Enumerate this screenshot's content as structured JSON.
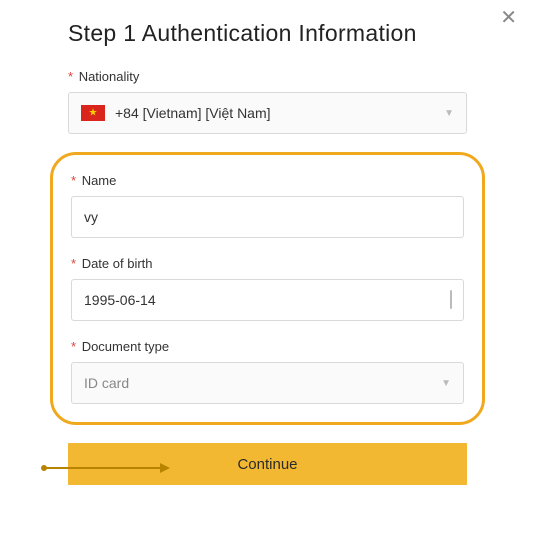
{
  "title": "Step 1 Authentication Information",
  "close_label": "✕",
  "nationality": {
    "label": "Nationality",
    "value": "+84 [Vietnam] [Việt Nam]"
  },
  "name": {
    "label": "Name",
    "value": "vy"
  },
  "dob": {
    "label": "Date of birth",
    "value": "1995-06-14"
  },
  "doctype": {
    "label": "Document type",
    "value": "ID card"
  },
  "continue_label": "Continue",
  "required_marker": "*",
  "chevron_glyph": "▼"
}
